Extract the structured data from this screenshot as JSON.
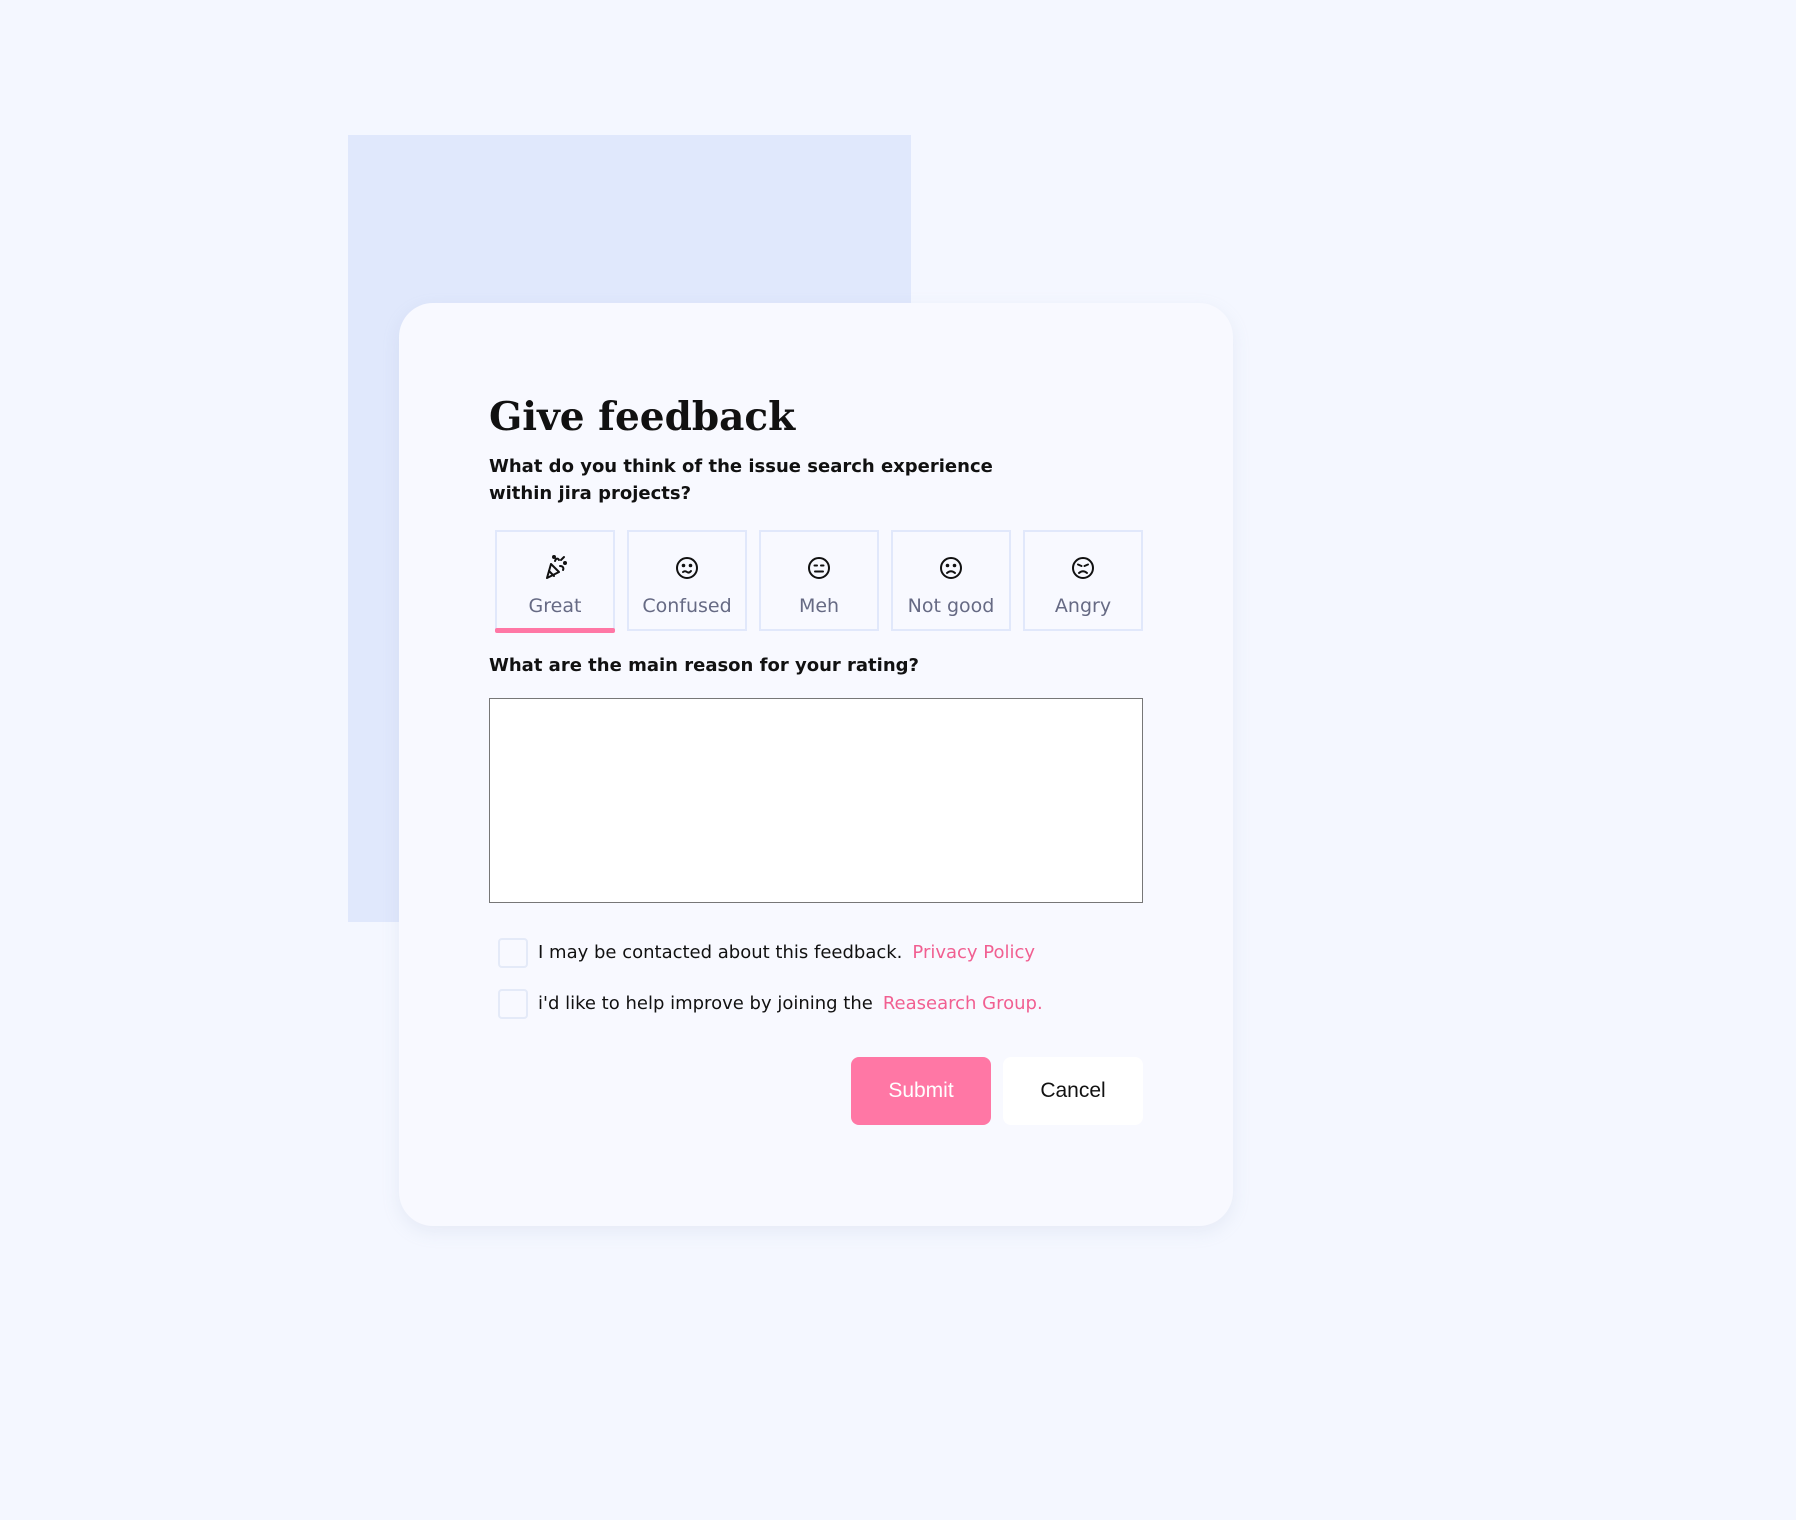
{
  "dialog": {
    "title": "Give feedback",
    "question": "What do you think of the issue search experience within jira projects?",
    "selected_rating": "Great",
    "ratings": [
      {
        "label": "Great",
        "icon": "party-popper-icon"
      },
      {
        "label": "Confused",
        "icon": "confused-face-icon"
      },
      {
        "label": "Meh",
        "icon": "neutral-face-icon"
      },
      {
        "label": "Not good",
        "icon": "sad-face-icon"
      },
      {
        "label": "Angry",
        "icon": "angry-face-icon"
      }
    ],
    "reason_label": "What are the main reason for your rating?",
    "reason_value": "",
    "checkboxes": [
      {
        "text": "I may be contacted about this feedback.",
        "link_text": "Privacy Policy",
        "checked": false
      },
      {
        "text": "i'd like to help improve by joining the",
        "link_text": "Reasearch Group.",
        "checked": false
      }
    ],
    "submit_label": "Submit",
    "cancel_label": "Cancel"
  },
  "colors": {
    "page_background": "#f4f7ff",
    "backdrop": "#e0e8fc",
    "card_background": "#f8f9ff",
    "accent": "#ff77a5",
    "link": "#f15f91",
    "border": "#e1e8fb",
    "text": "#111111",
    "muted_text": "#666a84"
  }
}
